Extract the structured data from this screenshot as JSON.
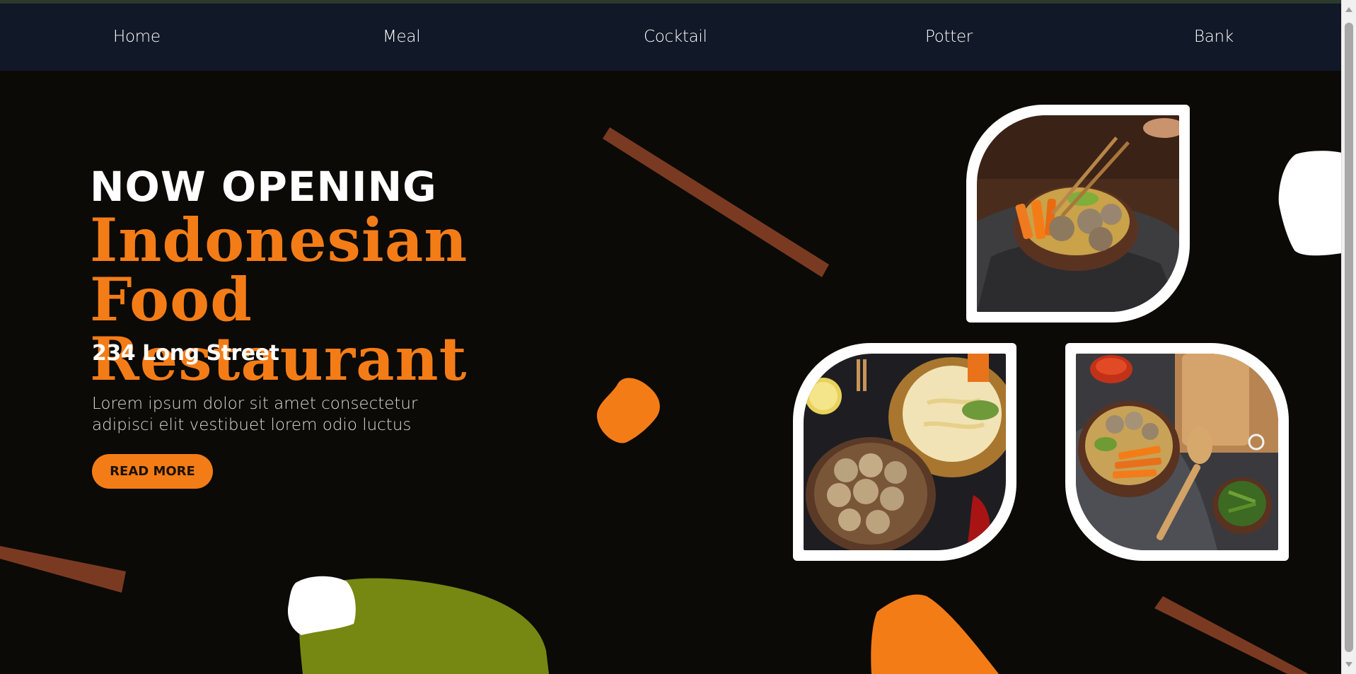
{
  "nav": {
    "items": [
      {
        "label": "Home"
      },
      {
        "label": "Meal"
      },
      {
        "label": "Cocktail"
      },
      {
        "label": "Potter"
      },
      {
        "label": "Bank"
      }
    ]
  },
  "hero": {
    "kicker": "NOW OPENING",
    "title_line1": "Indonesian Food",
    "title_line2": "Restaurant",
    "address": "234  Long Street",
    "body_line1": "Lorem ipsum dolor sit amet consectetur",
    "body_line2": "adipisci elit vestibuet lorem odio luctus",
    "cta_label": "READ MORE"
  },
  "colors": {
    "accent": "#f47c17",
    "nav_bg": "#111827",
    "page_bg": "#0b0a06",
    "chopstick": "#7a3a22",
    "olive": "#768812"
  },
  "images": {
    "top": "meatballs-bowl-chopsticks-image",
    "bottom_left": "meatballs-noodles-image",
    "bottom_right": "meatball-soup-spoon-board-image"
  }
}
